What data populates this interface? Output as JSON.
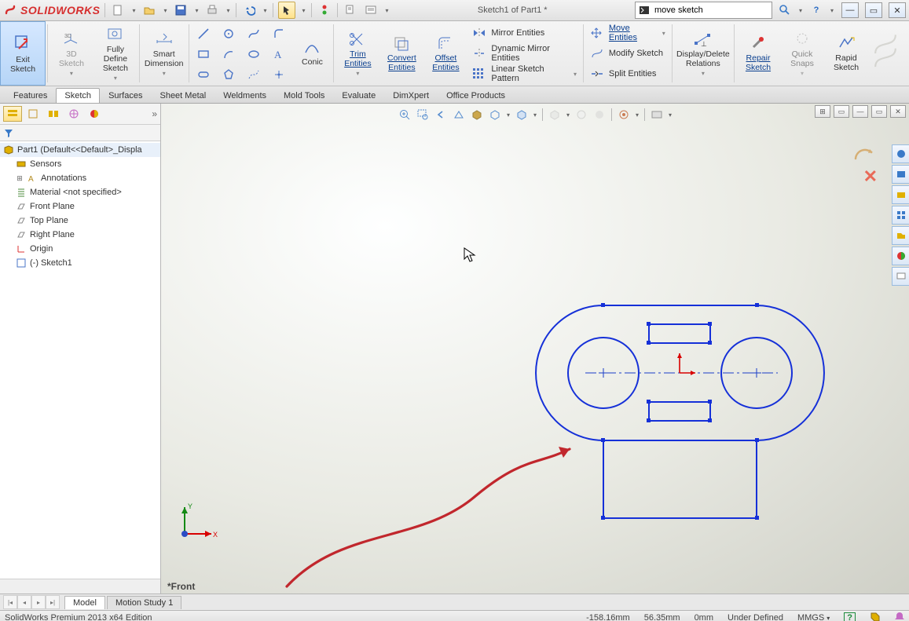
{
  "app_name": "SOLIDWORKS",
  "document_title": "Sketch1 of Part1 *",
  "search": {
    "placeholder": "",
    "value": "move sketch"
  },
  "ribbon": {
    "exit_sketch": "Exit\nSketch",
    "sketch3d": "3D\nSketch",
    "fully_define": "Fully\nDefine\nSketch",
    "smart_dim": "Smart\nDimension",
    "conic": "Conic",
    "trim": "Trim\nEntities",
    "convert": "Convert\nEntities",
    "offset": "Offset\nEntities",
    "mirror": "Mirror Entities",
    "dynmirror": "Dynamic Mirror Entities",
    "linpattern": "Linear Sketch Pattern",
    "move": "Move Entities",
    "modify": "Modify Sketch",
    "split": "Split Entities",
    "disprel": "Display/Delete\nRelations",
    "repair": "Repair\nSketch",
    "quicksnaps": "Quick\nSnaps",
    "rapid": "Rapid\nSketch"
  },
  "feature_tabs": [
    "Features",
    "Sketch",
    "Surfaces",
    "Sheet Metal",
    "Weldments",
    "Mold Tools",
    "Evaluate",
    "DimXpert",
    "Office Products"
  ],
  "active_feature_tab": 1,
  "tree": {
    "root": "Part1  (Default<<Default>_Displa",
    "items": [
      {
        "label": "Sensors",
        "icon": "sensor"
      },
      {
        "label": "Annotations",
        "icon": "annot",
        "expandable": true
      },
      {
        "label": "Material <not specified>",
        "icon": "material"
      },
      {
        "label": "Front Plane",
        "icon": "plane"
      },
      {
        "label": "Top Plane",
        "icon": "plane"
      },
      {
        "label": "Right Plane",
        "icon": "plane"
      },
      {
        "label": "Origin",
        "icon": "origin"
      },
      {
        "label": "(-) Sketch1",
        "icon": "sketch"
      }
    ]
  },
  "view_label": "*Front",
  "bottom_tabs": [
    "Model",
    "Motion Study 1"
  ],
  "status": {
    "product": "SolidWorks Premium 2013 x64 Edition",
    "coord_x": "-158.16mm",
    "coord_y": "56.35mm",
    "coord_z": "0mm",
    "state": "Under Defined",
    "units": "MMGS"
  }
}
